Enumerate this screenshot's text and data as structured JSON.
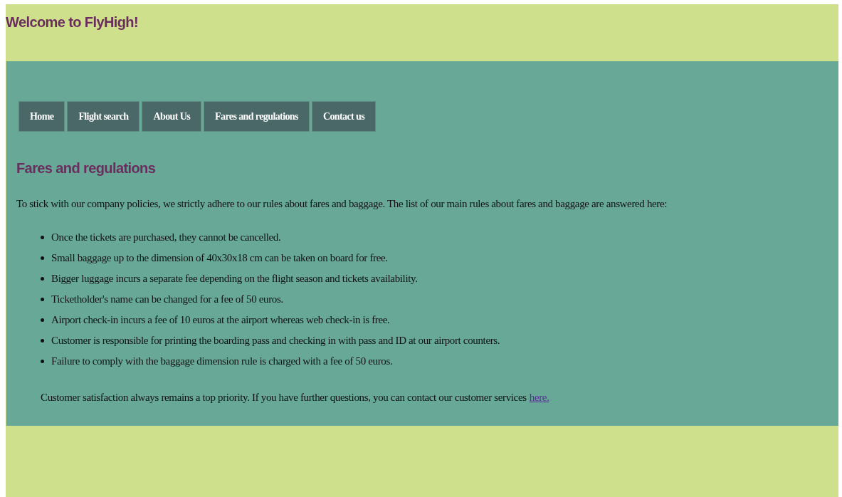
{
  "header": {
    "title": "Welcome to FlyHigh!"
  },
  "nav": [
    {
      "label": "Home"
    },
    {
      "label": "Flight search"
    },
    {
      "label": "About Us"
    },
    {
      "label": "Fares and regulations"
    },
    {
      "label": "Contact us"
    }
  ],
  "page": {
    "heading": "Fares and regulations",
    "intro": "To stick with our company policies, we strictly adhere to our rules about fares and baggage. The list of our main rules about fares and baggage are answered here:",
    "rules": [
      "Once the tickets are purchased, they cannot be cancelled.",
      "Small baggage up to the dimension of 40x30x18 cm can be taken on board for free.",
      "Bigger luggage incurs a separate fee depending on the flight season and tickets availability.",
      "Ticketholder's name can be changed for a fee of 50 euros.",
      "Airport check-in incurs a fee of 10 euros at the airport whereas web check-in is free.",
      "Customer is responsible for printing the boarding pass and checking in with pass and ID at our airport counters.",
      "Failure to comply with the baggage dimension rule is charged with a fee of 50 euros."
    ],
    "closing": "Customer satisfaction always remains a top priority. If you have further questions, you can contact our customer services",
    "closing_link": "here."
  }
}
